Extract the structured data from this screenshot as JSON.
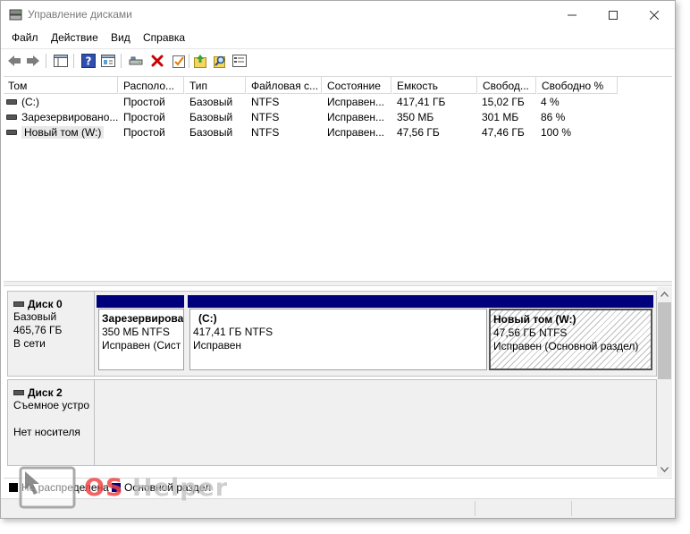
{
  "window": {
    "title": "Управление дисками"
  },
  "menu": [
    "Файл",
    "Действие",
    "Вид",
    "Справка"
  ],
  "toolbar": {
    "icons": [
      "back-icon",
      "forward-icon",
      "console-tree-icon",
      "help-icon",
      "properties-icon",
      "connect-icon",
      "delete-icon",
      "check-icon",
      "import-icon",
      "search-icon",
      "settings-list-icon"
    ]
  },
  "volume_list": {
    "columns": [
      "Том",
      "Располо...",
      "Тип",
      "Файловая с...",
      "Состояние",
      "Емкость",
      "Свобод...",
      "Свободно %"
    ],
    "rows": [
      {
        "name": "(C:)",
        "layout": "Простой",
        "type": "Базовый",
        "fs": "NTFS",
        "status": "Исправен...",
        "capacity": "417,41 ГБ",
        "free": "15,02 ГБ",
        "free_pct": "4 %"
      },
      {
        "name": "Зарезервировано...",
        "layout": "Простой",
        "type": "Базовый",
        "fs": "NTFS",
        "status": "Исправен...",
        "capacity": "350 МБ",
        "free": "301 МБ",
        "free_pct": "86 %"
      },
      {
        "name": "Новый том (W:)",
        "layout": "Простой",
        "type": "Базовый",
        "fs": "NTFS",
        "status": "Исправен...",
        "capacity": "47,56 ГБ",
        "free": "47,46 ГБ",
        "free_pct": "100 %"
      }
    ]
  },
  "disks": [
    {
      "title": "Диск 0",
      "lines": [
        "Базовый",
        "465,76 ГБ",
        "В сети"
      ],
      "partitions": [
        {
          "name": "Зарезервирова",
          "size": "350 МБ NTFS",
          "status": "Исправен (Сист"
        },
        {
          "name": "(C:)",
          "size": "417,41 ГБ NTFS",
          "status": "Исправен"
        },
        {
          "name": "Новый том  (W:)",
          "size": "47,56 ГБ NTFS",
          "status": "Исправен (Основной раздел)"
        }
      ]
    },
    {
      "title": "Диск 2",
      "lines": [
        "Съемное устро",
        "",
        "Нет носителя"
      ]
    }
  ],
  "legend": [
    {
      "label": "Не распределена",
      "color": "#000000"
    },
    {
      "label": "Основной раздел",
      "color": "#00007c"
    }
  ],
  "watermark": {
    "part1": "OS",
    "part2": "Helper"
  },
  "colors": {
    "partition_bar": "#00007c",
    "accent_red": "#cc0000"
  }
}
